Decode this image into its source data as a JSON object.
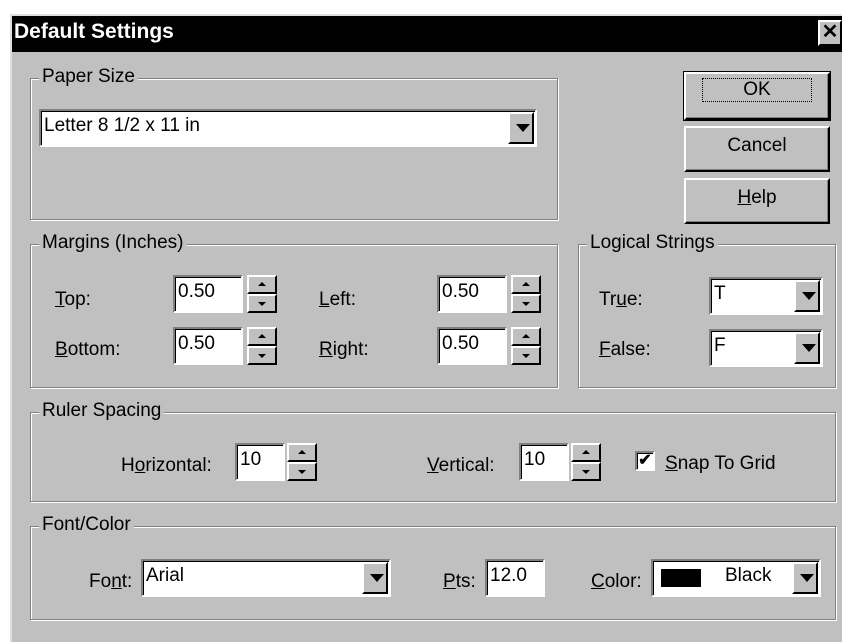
{
  "window": {
    "title": "Default Settings",
    "close_glyph": "✕"
  },
  "buttons": {
    "ok": "OK",
    "cancel": "Cancel",
    "help_pre": "",
    "help_u": "H",
    "help_post": "elp"
  },
  "paper_size": {
    "legend": "Paper Size",
    "value": "Letter 8 1/2 x 11 in"
  },
  "margins": {
    "legend": "Margins (Inches)",
    "top": {
      "u": "T",
      "rest": "op:",
      "value": "0.50"
    },
    "bottom": {
      "u": "B",
      "rest": "ottom:",
      "value": "0.50"
    },
    "left": {
      "u": "L",
      "rest": "eft:",
      "value": "0.50"
    },
    "right": {
      "u": "R",
      "rest": "ight:",
      "value": "0.50"
    }
  },
  "logical": {
    "legend": "Logical Strings",
    "true": {
      "pre": "Tr",
      "u": "u",
      "rest": "e:",
      "value": "T"
    },
    "false": {
      "u": "F",
      "rest": "alse:",
      "value": "F"
    }
  },
  "ruler": {
    "legend": "Ruler Spacing",
    "horizontal": {
      "pre": "H",
      "u": "o",
      "rest": "rizontal:",
      "value": "10"
    },
    "vertical": {
      "u": "V",
      "rest": "ertical:",
      "value": "10"
    },
    "snap": {
      "checked": true,
      "mark": "✔",
      "u": "S",
      "rest": "nap To Grid"
    }
  },
  "font_color": {
    "legend": "Font/Color",
    "font": {
      "pre": "Fo",
      "u": "n",
      "rest": "t:",
      "value": "Arial"
    },
    "pts": {
      "u": "P",
      "rest": "ts:",
      "value": "12.0"
    },
    "color": {
      "u": "C",
      "rest": "olor:",
      "value": "Black",
      "swatch": "#000000"
    }
  }
}
